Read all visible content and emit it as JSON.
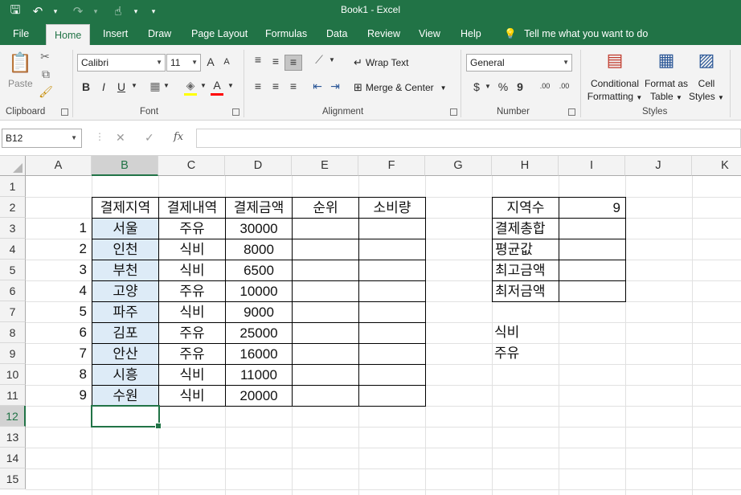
{
  "app": {
    "title": "Book1  -  Excel",
    "qat": {
      "save": "🖫",
      "undo": "↶",
      "redo": "↷",
      "touch": "☝",
      "customize": "▾"
    }
  },
  "tabs": [
    "File",
    "Home",
    "Insert",
    "Draw",
    "Page Layout",
    "Formulas",
    "Data",
    "Review",
    "View",
    "Help"
  ],
  "tell_me": "Tell me what you want to do",
  "ribbon": {
    "clipboard": {
      "label": "Clipboard",
      "paste": "Paste"
    },
    "font": {
      "label": "Font",
      "name": "Calibri",
      "size": "11",
      "bold": "B",
      "italic": "I",
      "underline": "U",
      "grow": "A",
      "shrink": "A",
      "font_color": "A"
    },
    "alignment": {
      "label": "Alignment",
      "wrap": "Wrap Text",
      "merge": "Merge & Center"
    },
    "number": {
      "label": "Number",
      "format": "General",
      "currency": "$",
      "percent": "%",
      "comma": "9",
      "inc_dec": ".00",
      "dec_dec": ".00"
    },
    "styles": {
      "label": "Styles",
      "cond1": "Conditional",
      "cond2": "Formatting",
      "fmt1": "Format as",
      "fmt2": "Table",
      "cell1": "Cell",
      "cell2": "Styles"
    }
  },
  "formula_bar": {
    "name_box": "B12",
    "cancel": "✕",
    "enter": "✓",
    "fx": "fx",
    "formula": ""
  },
  "columns": [
    "A",
    "B",
    "C",
    "D",
    "E",
    "F",
    "G",
    "H",
    "I",
    "J",
    "K"
  ],
  "rows": [
    "1",
    "2",
    "3",
    "4",
    "5",
    "6",
    "7",
    "8",
    "9",
    "10",
    "11",
    "12",
    "13",
    "14",
    "15"
  ],
  "table": {
    "headers": [
      "결제지역",
      "결제내역",
      "결제금액",
      "순위",
      "소비량"
    ],
    "rows": [
      {
        "no": "1",
        "region": "서울",
        "type": "주유",
        "amount": "30000"
      },
      {
        "no": "2",
        "region": "인천",
        "type": "식비",
        "amount": "8000"
      },
      {
        "no": "3",
        "region": "부천",
        "type": "식비",
        "amount": "6500"
      },
      {
        "no": "4",
        "region": "고양",
        "type": "주유",
        "amount": "10000"
      },
      {
        "no": "5",
        "region": "파주",
        "type": "식비",
        "amount": "9000"
      },
      {
        "no": "6",
        "region": "김포",
        "type": "주유",
        "amount": "25000"
      },
      {
        "no": "7",
        "region": "안산",
        "type": "주유",
        "amount": "16000"
      },
      {
        "no": "8",
        "region": "시흥",
        "type": "식비",
        "amount": "11000"
      },
      {
        "no": "9",
        "region": "수원",
        "type": "식비",
        "amount": "20000"
      }
    ]
  },
  "summary": {
    "labels": [
      "지역수",
      "결제총합",
      "평균값",
      "최고금액",
      "최저금액"
    ],
    "region_count": "9",
    "categories": [
      "식비",
      "주유"
    ]
  }
}
